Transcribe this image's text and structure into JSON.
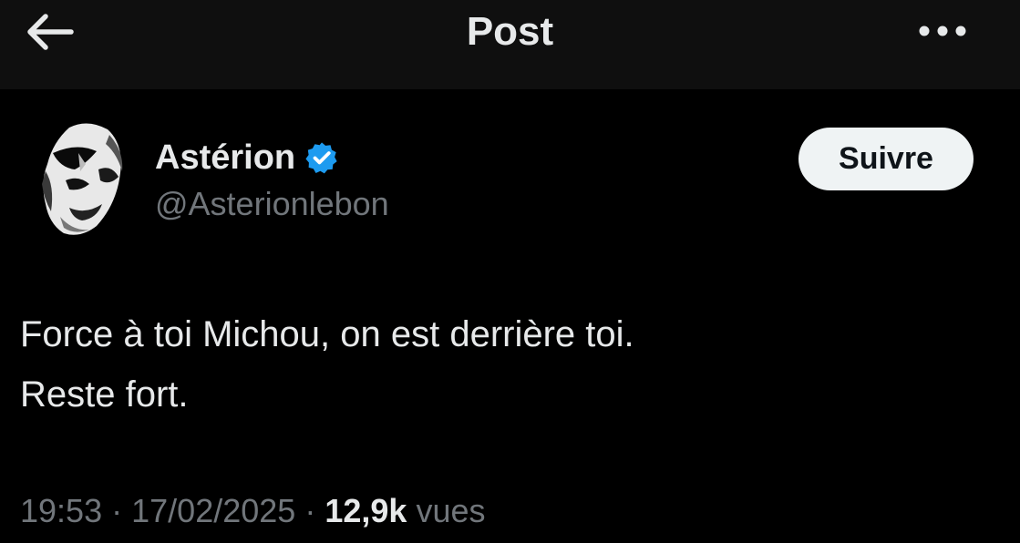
{
  "header": {
    "title": "Post",
    "back_icon": "back-arrow-icon",
    "more_icon": "more-dots-icon"
  },
  "author": {
    "display_name": "Astérion",
    "handle": "@Asterionlebon",
    "verified_icon": "verified-badge-icon",
    "verified_color": "#1d9bf0"
  },
  "follow_button": {
    "label": "Suivre"
  },
  "tweet": {
    "lines": [
      "Force à toi Michou, on est derrière toi.",
      "Reste fort."
    ]
  },
  "meta": {
    "time": "19:53",
    "separator": "·",
    "date": "17/02/2025",
    "views_count": "12,9k",
    "views_label": "vues"
  },
  "colors": {
    "background": "#000000",
    "header_background": "#0f0f0f",
    "text_primary": "#e7e9ea",
    "text_secondary": "#71767b",
    "button_background": "#eff3f4",
    "button_text": "#0f1419"
  }
}
